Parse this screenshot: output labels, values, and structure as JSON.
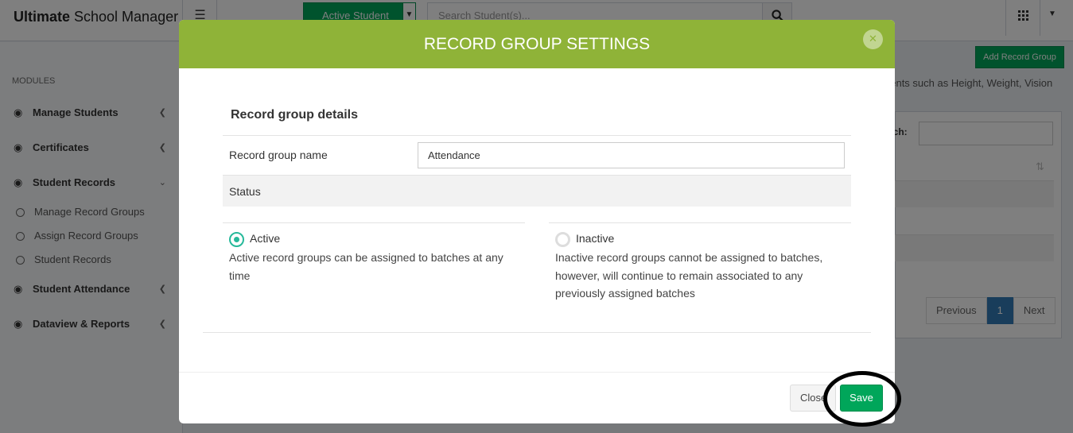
{
  "app": {
    "brand_bold": "Ultimate",
    "brand_rest": " School Manager"
  },
  "topbar": {
    "menu_icon": "hamburger-icon",
    "student_select": "Active Student",
    "search_placeholder": "Search Student(s)...",
    "search_icon": "search-icon",
    "apps_icon": "grid-icon",
    "user_caret_icon": "caret-down-icon"
  },
  "sidebar": {
    "header": "MODULES",
    "items": [
      {
        "label": "Manage Students",
        "icon": "dashboard-icon"
      },
      {
        "label": "Certificates",
        "icon": "dashboard-icon"
      },
      {
        "label": "Student Records",
        "icon": "dashboard-icon",
        "expanded": true
      },
      {
        "label": "Student Attendance",
        "icon": "dashboard-icon"
      },
      {
        "label": "Dataview & Reports",
        "icon": "dashboard-icon"
      }
    ],
    "subitems": [
      "Manage Record Groups",
      "Assign Record Groups",
      "Student Records"
    ]
  },
  "content": {
    "add_button": "Add Record Group",
    "description": "dents such as Height, Weight, Vision",
    "search_label": "rch:",
    "pagination": {
      "previous": "Previous",
      "current": "1",
      "next": "Next"
    }
  },
  "modal": {
    "title": "RECORD GROUP SETTINGS",
    "section_title": "Record group details",
    "name_label": "Record group name",
    "name_value": "Attendance",
    "status_label": "Status",
    "options": [
      {
        "label": "Active",
        "checked": true,
        "description_line1": "Active record groups can be assigned to batches at any",
        "description_line2": "time",
        "description_line3": ""
      },
      {
        "label": "Inactive",
        "checked": false,
        "description_line1": "Inactive record groups cannot be assigned to batches,",
        "description_line2": "however, will continue to remain associated to any",
        "description_line3": "previously assigned batches"
      }
    ],
    "close_button": "Close",
    "save_button": "Save"
  },
  "colors": {
    "modal_header": "#8fb338",
    "primary_green": "#00a65a",
    "radio_accent": "#26b99a",
    "link_blue": "#337ab7"
  }
}
